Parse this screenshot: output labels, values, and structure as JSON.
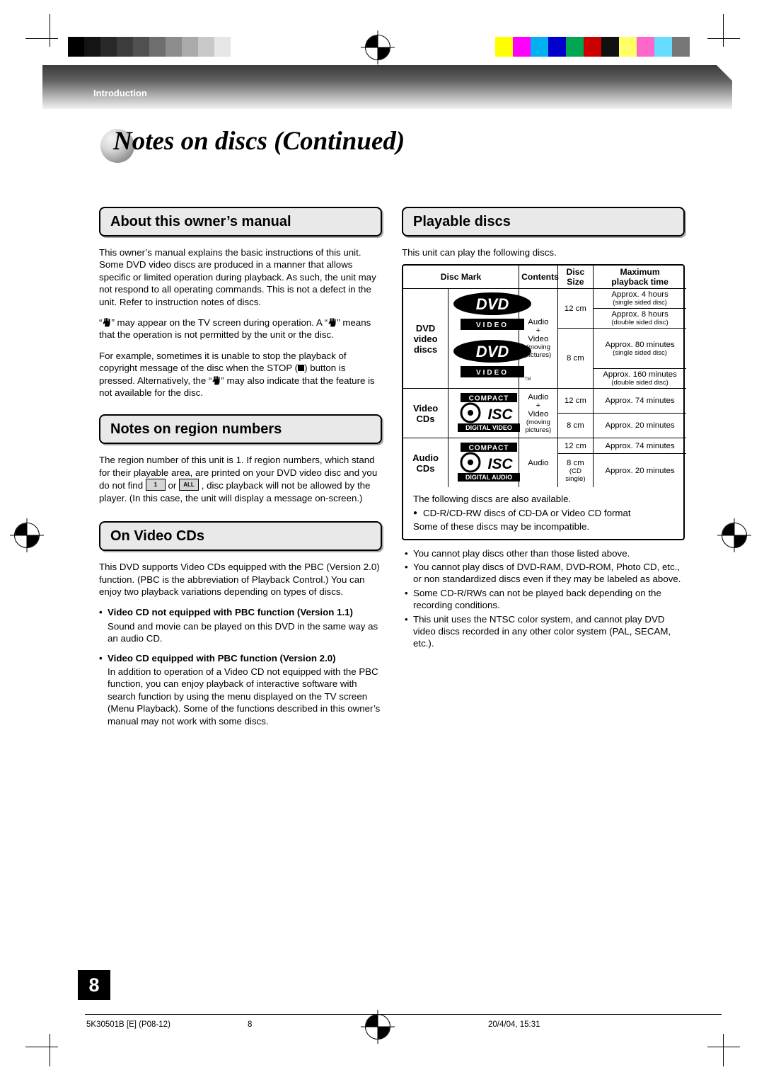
{
  "header": {
    "section_label": "Introduction"
  },
  "page_title": "Notes on discs (Continued)",
  "left": {
    "manual_heading": "About this owner’s manual",
    "manual_p1": "This owner’s manual explains the basic instructions of this unit. Some DVD video discs are produced in a manner that allows specific or limited operation during playback. As such, the unit may not respond to all operating commands. This is not a defect in the unit. Refer to instruction notes of discs.",
    "manual_p2_a": "“",
    "manual_p2_b": "” may appear on the TV screen during operation. A “",
    "manual_p2_c": "” means that the operation is not permitted by the unit or the disc.",
    "manual_p3_a": "For example, sometimes it is unable to stop the playback of copyright message of the disc when the STOP (",
    "manual_p3_b": ") button is pressed. Alternatively, the “",
    "manual_p3_c": "” may also indicate that the feature is not available for the disc.",
    "region_heading": "Notes on region numbers",
    "region_p_a": "The region number of this unit is 1. If region numbers, which stand for their playable area, are printed on your DVD video disc and you do not find ",
    "region_p_b": " or ",
    "region_p_c": " , disc playback will not be allowed by the player. (In this case, the unit will display a message on-screen.)",
    "region_mark_1": "1",
    "region_mark_2": "ALL",
    "videocd_heading": "On Video CDs",
    "videocd_p1": "This DVD supports Video CDs equipped with the PBC (Version 2.0) function. (PBC is the abbreviation of Playback Control.) You can enjoy two playback variations depending on types of discs.",
    "videocd_b1": "Video CD not equipped with PBC function (Version 1.1)",
    "videocd_t1": "Sound and movie can be played on this DVD in the same way as an audio CD.",
    "videocd_b2": "Video CD equipped with PBC function (Version 2.0)",
    "videocd_t2": "In addition to operation of a Video CD not equipped with the PBC function, you can enjoy playback of interactive software with search function by using the menu displayed on the TV screen (Menu Playback). Some of the functions described in this owner’s manual may not work with some discs."
  },
  "right": {
    "playable_heading": "Playable discs",
    "playable_intro": "This unit can play the following discs.",
    "table": {
      "headers": {
        "disc_mark": "Disc Mark",
        "contents": "Contents",
        "disc_size_l1": "Disc",
        "disc_size_l2": "Size",
        "max_l1": "Maximum",
        "max_l2": "playback time"
      },
      "rows": [
        {
          "label_l1": "DVD",
          "label_l2": "video",
          "label_l3": "discs",
          "mark": "dvd-video-logo",
          "contents_l1": "Audio",
          "contents_l2": "+",
          "contents_l3": "Video",
          "contents_l4": "(moving",
          "contents_l5": "pictures)",
          "sizes": [
            {
              "size": "12 cm",
              "times": [
                {
                  "main": "Approx. 4 hours",
                  "sub": "(single sided disc)"
                },
                {
                  "main": "Approx. 8 hours",
                  "sub": "(double sided disc)"
                }
              ]
            },
            {
              "size": "8 cm",
              "times": [
                {
                  "main": "Approx. 80 minutes",
                  "sub": "(single sided disc)"
                },
                {
                  "main": "Approx. 160 minutes",
                  "sub": "(double sided disc)"
                }
              ]
            }
          ]
        },
        {
          "label_l1": "Video",
          "label_l2": "CDs",
          "mark": "compact-disc-digital-video-logo",
          "mark_top": "COMPACT",
          "mark_bottom": "DIGITAL VIDEO",
          "contents_l1": "Audio",
          "contents_l2": "+",
          "contents_l3": "Video",
          "contents_l4": "(moving",
          "contents_l5": "pictures)",
          "sizes": [
            {
              "size": "12 cm",
              "times": [
                {
                  "main": "Approx. 74 minutes",
                  "sub": ""
                }
              ]
            },
            {
              "size": "8 cm",
              "times": [
                {
                  "main": "Approx. 20 minutes",
                  "sub": ""
                }
              ]
            }
          ]
        },
        {
          "label_l1": "Audio",
          "label_l2": "CDs",
          "mark": "compact-disc-digital-audio-logo",
          "mark_top": "COMPACT",
          "mark_bottom": "DIGITAL AUDIO",
          "contents_l1": "Audio",
          "sizes": [
            {
              "size": "12 cm",
              "times": [
                {
                  "main": "Approx. 74 minutes",
                  "sub": ""
                }
              ]
            },
            {
              "size": "8 cm",
              "size_l2": "(CD",
              "size_l3": "single)",
              "times": [
                {
                  "main": "Approx. 20 minutes",
                  "sub": ""
                }
              ]
            }
          ]
        }
      ]
    },
    "also_available": "The following discs are also available.",
    "also_bullet": "CD-R/CD-RW discs of CD-DA or Video CD format",
    "also_note": "Some of these discs may be incompatible.",
    "notes": [
      "You cannot play discs other than those listed above.",
      "You cannot play discs of DVD-RAM, DVD-ROM, Photo CD, etc., or non standardized discs even if they may be labeled as above.",
      "Some CD-R/RWs can not be played back depending on the recording conditions.",
      "This unit uses the NTSC color system, and cannot play DVD video discs recorded in any other color system (PAL, SECAM, etc.)."
    ]
  },
  "footer": {
    "left": "5K30501B [E] (P08-12)",
    "center": "8",
    "right": "20/4/04, 15:31",
    "page_number": "8"
  },
  "colors": {
    "header_dark": "#3a3a3a",
    "header_light": "#f2f2f2",
    "section_fill": "#e9e9e9",
    "page_bg": "#ffffff"
  },
  "grayscale_steps": [
    "#000000",
    "#141414",
    "#282828",
    "#3c3c3c",
    "#505050",
    "#6e6e6e",
    "#8c8c8c",
    "#aaaaaa",
    "#c8c8c8",
    "#e6e6e6",
    "#ffffff"
  ],
  "color_steps": [
    "#ffff00",
    "#ff00ff",
    "#00b0f0",
    "#0000cc",
    "#00a651",
    "#cc0000",
    "#111111",
    "#ffff66",
    "#ff66cc",
    "#66ddff",
    "#777777"
  ]
}
